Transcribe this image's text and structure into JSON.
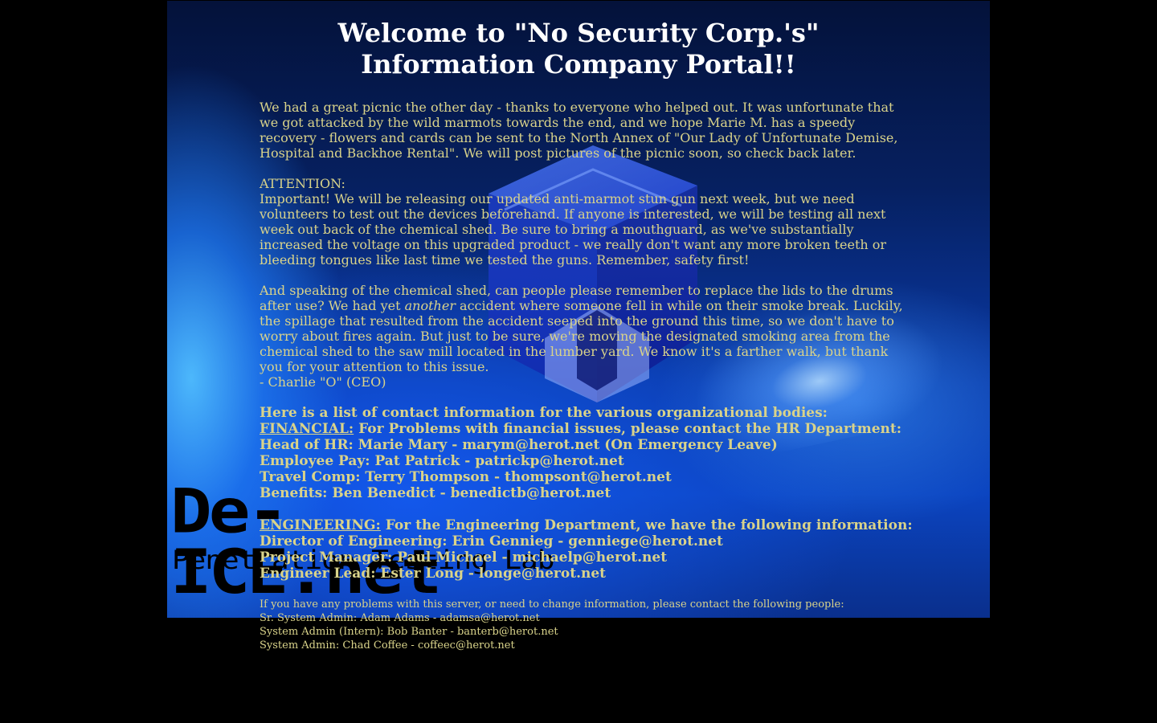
{
  "page": {
    "title_line1": "Welcome to \"No Security Corp.'s\"",
    "title_line2": "Information Company Portal!!"
  },
  "logo": {
    "main": "De-ICE.net",
    "sub": "Penetration Testing Lab"
  },
  "news": {
    "p1": [
      "We had a great picnic the other day - thanks to everyone who helped out. It was unfortunate that",
      "we got attacked by the wild marmots towards the end, and we hope Marie M. has a speedy",
      "recovery - flowers and cards can be sent to the North Annex of \"Our Lady of Unfortunate Demise,",
      "Hospital and Backhoe Rental\". We will post pictures of the picnic soon, so check back later."
    ],
    "attention_label": "ATTENTION:",
    "p2": [
      "Important! We will be releasing our updated anti-marmot stun gun next week, but we need",
      "volunteers to test out the devices beforehand. If anyone is interested, we will be testing all next",
      "week out back of the chemical shed. Be sure to bring a mouthguard, as we've substantially",
      "increased the voltage on this upgraded product - we really don't want any more broken teeth or",
      "bleeding tongues like last time we tested the guns. Remember, safety first!"
    ],
    "p3_line1": "And speaking of the chemical shed, can people please remember to replace the lids to the drums",
    "p3_line2_pre": "after use? We had yet ",
    "p3_line2_em": "another",
    "p3_line2_post": " accident where someone fell in while on their smoke break. Luckily,",
    "p3_rest": [
      "the spillage that resulted from the accident seeped into the ground this time, so we don't have to",
      "worry about fires again. But just to be sure, we're moving the designated smoking area from the",
      "chemical shed to the saw mill located in the lumber yard. We know it's a farther walk, but thank",
      "you for your attention to this issue."
    ],
    "signature": "- Charlie \"O\" (CEO)"
  },
  "contacts": {
    "intro": "Here is a list of contact information for the various organizational bodies:",
    "financial_label": "FINANCIAL:",
    "financial_text": " For Problems with financial issues, please contact the HR Department:",
    "financial_list": [
      "Head of HR: Marie Mary - marym@herot.net (On Emergency Leave)",
      "Employee Pay: Pat Patrick - patrickp@herot.net",
      "Travel Comp: Terry Thompson - thompsont@herot.net",
      "Benefits: Ben Benedict - benedictb@herot.net"
    ],
    "engineering_label": "ENGINEERING:",
    "engineering_text": " For the Engineering Department, we have the following information:",
    "engineering_list": [
      "Director of Engineering: Erin Gennieg - genniege@herot.net",
      "Project Manager: Paul Michael - michaelp@herot.net",
      "Engineer Lead: Ester Long - longe@herot.net"
    ]
  },
  "admin": {
    "intro": "If you have any problems with this server, or need to change information, please contact the following people:",
    "list": [
      "Sr. System Admin: Adam Adams - adamsa@herot.net",
      "System Admin (Intern): Bob Banter - banterb@herot.net",
      "System Admin: Chad Coffee - coffeec@herot.net"
    ]
  },
  "colors": {
    "page_bg": "#000000",
    "title": "#ffffff",
    "body_text": "#d9d38a",
    "banner_blue": "#0b44c0"
  }
}
